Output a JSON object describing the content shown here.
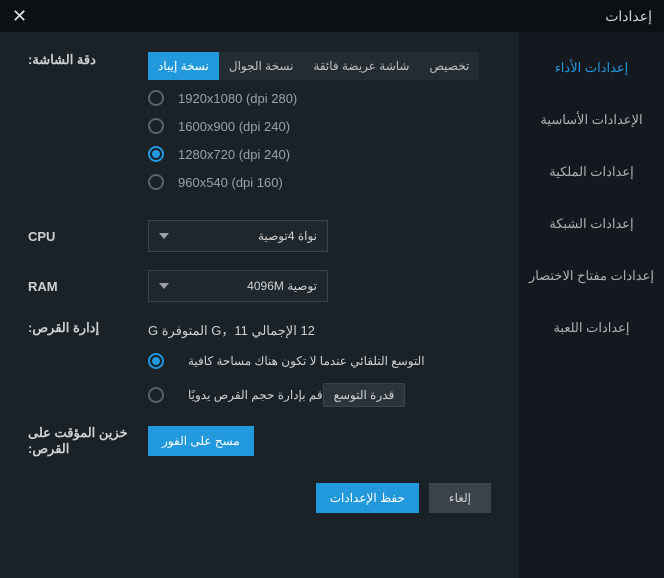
{
  "window": {
    "title": "إعدادات"
  },
  "sidebar": {
    "items": [
      {
        "label": "إعدادات الأداء"
      },
      {
        "label": "الإعدادات الأساسية"
      },
      {
        "label": "إعدادات الملكية"
      },
      {
        "label": "إعدادات الشبكة"
      },
      {
        "label": "إعدادات مفتاح الاختصار"
      },
      {
        "label": "إعدادات اللعبة"
      }
    ]
  },
  "resolution": {
    "label": "دقة الشاشة:",
    "tabs": [
      {
        "label": "نسخة إيباد"
      },
      {
        "label": "نسخة الجوال"
      },
      {
        "label": "شاشة عريضة فائقة"
      },
      {
        "label": "تخصيص"
      }
    ],
    "options": [
      {
        "label": "1920x1080  (dpi 280)"
      },
      {
        "label": "1600x900  (dpi 240)"
      },
      {
        "label": "1280x720  (dpi 240)"
      },
      {
        "label": "960x540  (dpi 160)"
      }
    ]
  },
  "cpu": {
    "label": "CPU",
    "value": "نواة 4توصية"
  },
  "ram": {
    "label": "RAM",
    "value": "توصية 4096M"
  },
  "disk": {
    "label": "إدارة القرص:",
    "info": "12 الإجمالي G，11 المتوفرة G",
    "auto": "التوسع التلقائي عندما لا تكون هناك مساحة كافية",
    "manual": "قم بإدارة حجم القرص يدويًا",
    "chip": "قدرة التوسع"
  },
  "cache": {
    "label": "خزين المؤقت على القرص:",
    "button": "مسح على الفور"
  },
  "footer": {
    "save": "حفظ الإعدادات",
    "cancel": "إلغاء"
  }
}
